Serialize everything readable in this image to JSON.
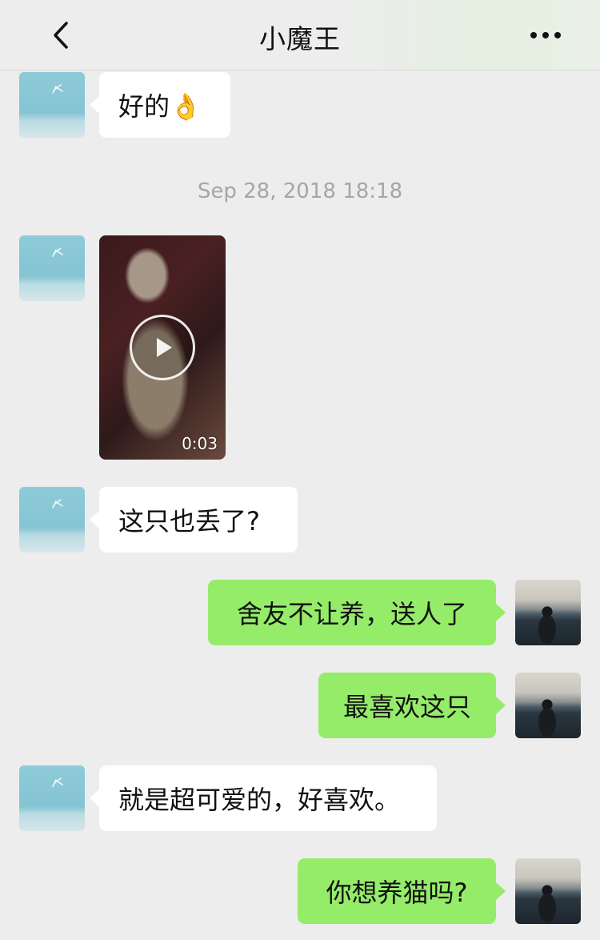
{
  "header": {
    "title": "小魔王",
    "back_icon": "chevron-left-icon",
    "more_icon": "more-dots-icon"
  },
  "timestamp": "Sep 28, 2018 18:18",
  "messages": [
    {
      "side": "left",
      "type": "text",
      "text": "好的👌"
    },
    {
      "side": "left",
      "type": "video",
      "duration": "0:03",
      "icon": "play-icon"
    },
    {
      "side": "left",
      "type": "text",
      "text": "这只也丢了?"
    },
    {
      "side": "right",
      "type": "text",
      "text": "舍友不让养，送人了"
    },
    {
      "side": "right",
      "type": "text",
      "text": "最喜欢这只"
    },
    {
      "side": "left",
      "type": "text",
      "text": "就是超可爱的，好喜欢。"
    },
    {
      "side": "right",
      "type": "text",
      "text": "你想养猫吗?"
    }
  ],
  "colors": {
    "background": "#ededed",
    "incoming_bubble": "#ffffff",
    "outgoing_bubble": "#95ec69",
    "timestamp_text": "#a6a6a6"
  }
}
